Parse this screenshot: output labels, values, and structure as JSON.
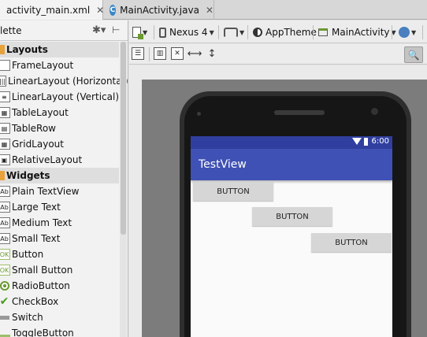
{
  "tabs": [
    {
      "label": "activity_main.xml",
      "close": "✕"
    },
    {
      "label": "MainActivity.java",
      "close": "✕"
    }
  ],
  "palette": {
    "title": "lette",
    "groups": [
      {
        "name": "Layouts",
        "items": [
          "FrameLayout",
          "LinearLayout (Horizontal)",
          "LinearLayout (Vertical)",
          "TableLayout",
          "TableRow",
          "GridLayout",
          "RelativeLayout"
        ]
      },
      {
        "name": "Widgets",
        "items": [
          "Plain TextView",
          "Large Text",
          "Medium Text",
          "Small Text",
          "Button",
          "Small Button",
          "RadioButton",
          "CheckBox",
          "Switch",
          "ToggleButton"
        ]
      }
    ]
  },
  "toolbar": {
    "device": "Nexus 4",
    "theme": "AppTheme",
    "activity": "MainActivity"
  },
  "preview": {
    "status_time": "6:00",
    "app_title": "TestView",
    "buttons": [
      "BUTTON",
      "BUTTON",
      "BUTTON"
    ]
  },
  "colors": {
    "status_bar": "#303f9f",
    "app_bar": "#3f51b5",
    "button_bg": "#d6d6d6"
  }
}
